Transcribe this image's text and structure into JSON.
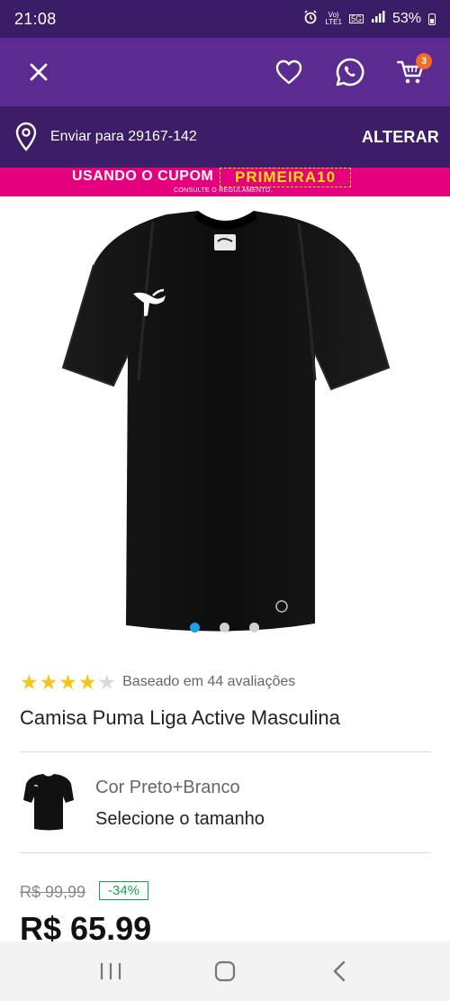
{
  "status": {
    "time": "21:08",
    "network_top": "Vo)",
    "network_bottom": "LTE1",
    "signal": "5G",
    "battery": "53%"
  },
  "header": {
    "cart_count": "3"
  },
  "shipping": {
    "label": "Enviar para 29167-142",
    "action": "ALTERAR"
  },
  "promo": {
    "text": "USANDO O CUPOM",
    "code": "PRIMEIRA10",
    "rules": "CONSULTE O REGULAMENTO."
  },
  "product": {
    "rating": 4,
    "rating_max": 5,
    "reviews_text": "Baseado em 44 avaliações",
    "title": "Camisa Puma Liga Active Masculina",
    "color_label": "Cor Preto+Branco",
    "size_prompt": "Selecione o tamanho",
    "old_price": "R$ 99,99",
    "discount": "-34%",
    "price": "R$ 65.99"
  },
  "gallery": {
    "current": 1,
    "total": 3
  },
  "colors": {
    "status_bar": "#3a1c67",
    "top_bar": "#5b2b92",
    "ship_bar": "#3d1c68",
    "promo_bg": "#e5007d",
    "promo_code": "#ffe600",
    "badge": "#f26b22",
    "star": "#f5c518",
    "discount": "#16a34a",
    "active_dot": "#1e9fe0"
  },
  "icons": [
    "close-icon",
    "heart-icon",
    "whatsapp-icon",
    "cart-icon",
    "location-pin-icon",
    "recents-icon",
    "home-icon",
    "back-icon"
  ]
}
